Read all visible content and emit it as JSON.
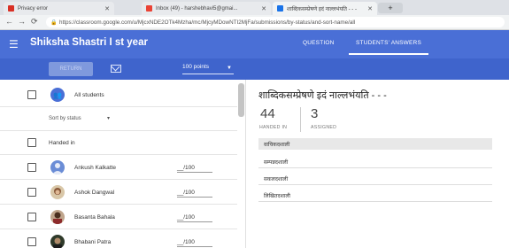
{
  "browser": {
    "tabs": [
      {
        "label": "Privacy error",
        "active": false
      },
      {
        "label": "Inbox (49) - harshebhavi5@gmai...",
        "active": false
      },
      {
        "label": "शाब्दिकसम्प्रेषणे इदं नाल्लभंयति - - -",
        "active": true
      }
    ],
    "new_tab_label": "+",
    "url": "https://classroom.google.com/u/MjcxNDE2OTk4Mzha/mc/MjcyMDowNTI2MjFa/submissions/by-status/and-sort-name/all"
  },
  "header": {
    "course_title": "Shiksha Shastri I st year",
    "tabs": [
      {
        "label": "QUESTION",
        "active": false
      },
      {
        "label": "STUDENTS' ANSWERS",
        "active": true
      }
    ]
  },
  "toolbar": {
    "return_label": "RETURN",
    "points_value": "100 points"
  },
  "left": {
    "all_students_label": "All students",
    "sort_label": "Sort by status",
    "section_handed_in": "Handed in",
    "students": [
      {
        "name": "Ankush Kalkatte",
        "grade": "__/100"
      },
      {
        "name": "Ashok Dangwal",
        "grade": "__/100"
      },
      {
        "name": "Basanta Bahala",
        "grade": "__/100"
      },
      {
        "name": "Bhabani Patra",
        "grade": "__/100"
      }
    ]
  },
  "right": {
    "assignment_title": "शाब्दिकसम्प्रेषणे इदं नाल्लभंयति - - -",
    "handed_in_count": "44",
    "handed_in_label": "HANDED IN",
    "assigned_count": "3",
    "assigned_label": "ASSIGNED",
    "answers": [
      "वाचिकदशाली",
      "सम्पन्नदशाली",
      "सकलदशाली",
      "लिखितदशाली"
    ]
  },
  "colors": {
    "header_blue": "#4a6fd6",
    "toolbar_blue": "#3f64cc"
  }
}
